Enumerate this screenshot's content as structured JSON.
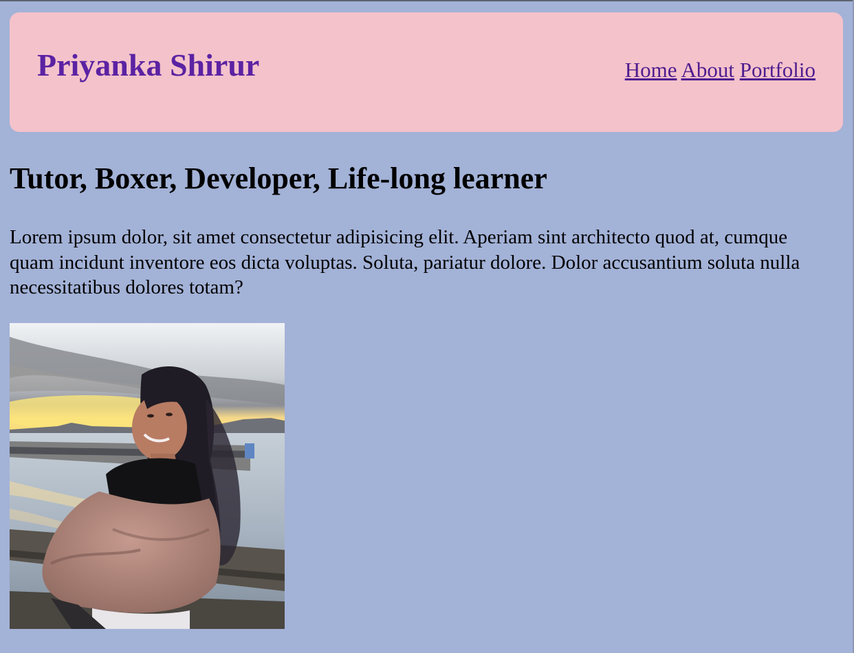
{
  "header": {
    "brand": "Priyanka Shirur",
    "nav": [
      {
        "label": "Home"
      },
      {
        "label": "About"
      },
      {
        "label": "Portfolio"
      }
    ]
  },
  "main": {
    "headline": "Tutor, Boxer, Developer, Life-long learner",
    "intro": "Lorem ipsum dolor, sit amet consectetur adipisicing elit. Aperiam sint architecto quod at, cumque quam incidunt inventore eos dicta voluptas. Soluta, pariatur dolore. Dolor accusantium soluta nulla necessitatibus dolores totam?",
    "photo": {
      "icon": "profile-photo",
      "subject": "smiling woman in pink fleece jacket on a pier at sunset"
    }
  },
  "colors": {
    "page_background": "#a3b2d7",
    "header_background": "#f4c2cb",
    "brand": "#5b22a3",
    "nav_link": "#4e1d8f"
  }
}
